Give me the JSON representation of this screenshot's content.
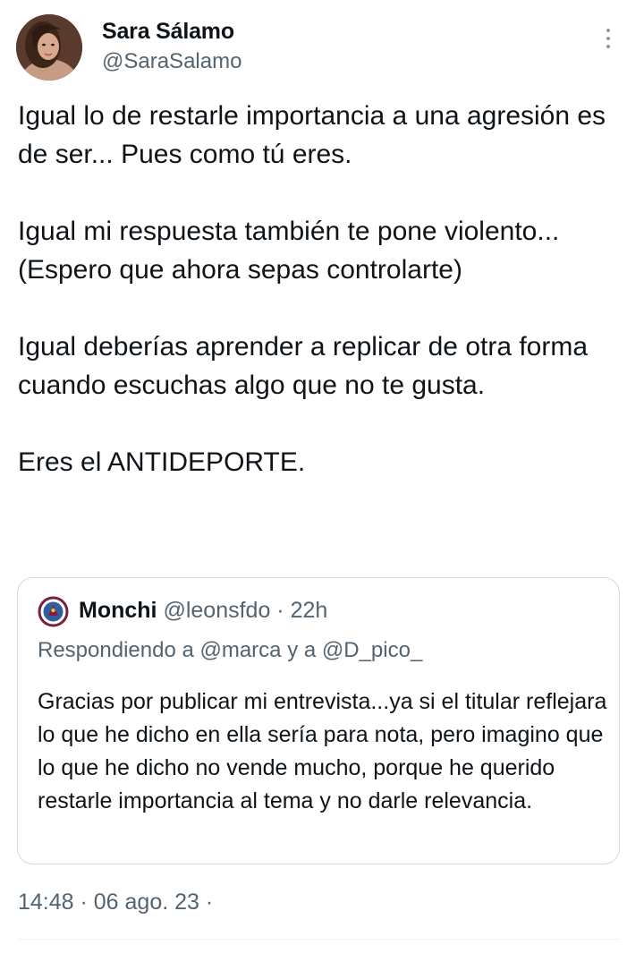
{
  "author": {
    "name": "Sara Sálamo",
    "handle": "@SaraSalamo"
  },
  "tweet": {
    "paragraphs": [
      "Igual lo de restarle importancia a una agresión es de ser... Pues como tú eres.",
      "Igual mi respuesta también te pone violento... (Espero que ahora sepas controlarte)",
      "Igual deberías aprender a replicar de otra forma cuando escuchas algo que no te gusta.",
      "Eres el ANTIDEPORTE."
    ]
  },
  "quoted_tweet": {
    "name": "Monchi",
    "meta": "@leonsfdo · 22h",
    "replying_to": "Respondiendo a @marca y a @D_pico_",
    "text": "Gracias por publicar mi entrevista...ya si el titular reflejara lo que he dicho en ella sería para nota, pero imagino que lo que he dicho no vende mucho, porque he querido restarle importancia al tema y no darle relevancia."
  },
  "timestamp": "14:48 · 06 ago. 23 ·",
  "icons": {
    "more": "more-vertical-icon"
  },
  "colors": {
    "text_primary": "#0f1419",
    "text_secondary": "#536471",
    "border": "#cfd9de"
  }
}
